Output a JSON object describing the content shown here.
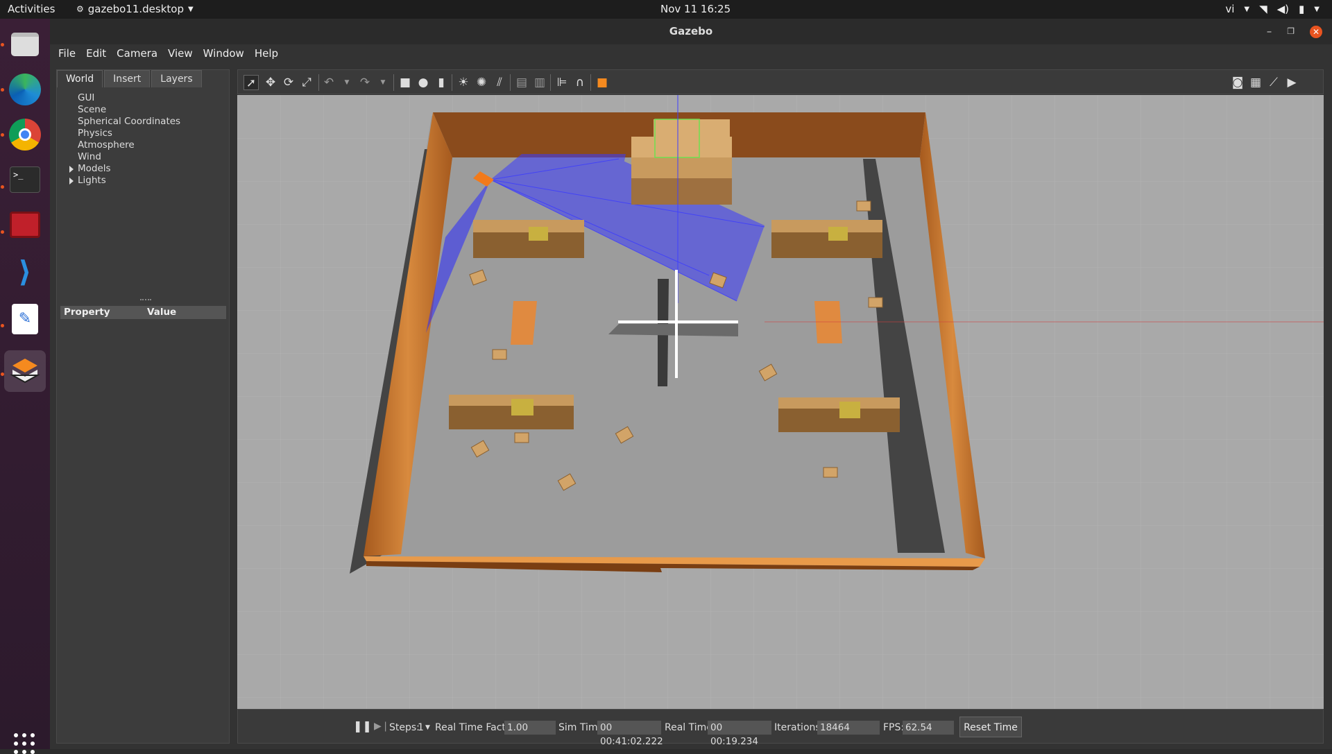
{
  "topbar": {
    "activities": "Activities",
    "app_menu": "gazebo11.desktop",
    "clock": "Nov 11  16:25",
    "input_lang": "vi"
  },
  "dock": {
    "items": [
      {
        "name": "files"
      },
      {
        "name": "edge"
      },
      {
        "name": "chrome"
      },
      {
        "name": "terminal"
      },
      {
        "name": "app-red"
      },
      {
        "name": "vscode"
      },
      {
        "name": "text-editor"
      },
      {
        "name": "gazebo"
      }
    ]
  },
  "window": {
    "title": "Gazebo",
    "menu": [
      "File",
      "Edit",
      "Camera",
      "View",
      "Window",
      "Help"
    ]
  },
  "left_panel": {
    "tabs": [
      "World",
      "Insert",
      "Layers"
    ],
    "active_tab": "World",
    "tree": [
      "GUI",
      "Scene",
      "Spherical Coordinates",
      "Physics",
      "Atmosphere",
      "Wind",
      "Models",
      "Lights"
    ],
    "prop_header": {
      "property": "Property",
      "value": "Value"
    }
  },
  "bottom_bar": {
    "steps_label": "Steps:",
    "steps_value": "1",
    "rtf_label": "Real Time Factor:",
    "rtf_value": "1.00",
    "sim_time_label": "Sim Time:",
    "sim_time_value": "00 00:41:02.222",
    "real_time_label": "Real Time:",
    "real_time_value": "00 00:19.234",
    "iterations_label": "Iterations:",
    "iterations_value": "18464",
    "fps_label": "FPS:",
    "fps_value": "62.54",
    "reset_label": "Reset Time"
  },
  "colors": {
    "accent": "#e95420",
    "wall": "#c8782e",
    "laser": "#3a3aff",
    "floor": "#9c9c9c"
  }
}
